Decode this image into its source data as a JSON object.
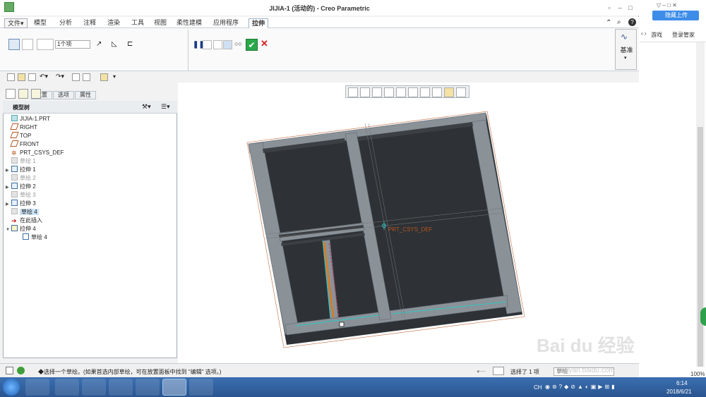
{
  "window": {
    "title": "JIJIA-1 (活动的) - Creo Parametric",
    "controls": [
      "?",
      "–",
      "□",
      "✕"
    ]
  },
  "menu": {
    "items": [
      "文件▾",
      "模型",
      "分析",
      "注释",
      "渲染",
      "工具",
      "视图",
      "柔性建模",
      "应用程序",
      "拉伸"
    ]
  },
  "ribbon": {
    "depth_value": "1个项",
    "subtabs": [
      "放置",
      "选项",
      "属性"
    ],
    "datum_label": "基准"
  },
  "tree": {
    "title": "模型树",
    "nodes": [
      {
        "label": "JIJIA-1.PRT",
        "icon": "part-icon",
        "level": 0,
        "exp": "",
        "state": "normal"
      },
      {
        "label": "RIGHT",
        "icon": "datum-plane-icon",
        "level": 1,
        "exp": "",
        "state": "normal"
      },
      {
        "label": "TOP",
        "icon": "datum-plane-icon",
        "level": 1,
        "exp": "",
        "state": "normal"
      },
      {
        "label": "FRONT",
        "icon": "datum-plane-icon",
        "level": 1,
        "exp": "",
        "state": "normal"
      },
      {
        "label": "PRT_CSYS_DEF",
        "icon": "csys-icon",
        "level": 1,
        "exp": "",
        "state": "normal"
      },
      {
        "label": "草绘 1",
        "icon": "sketch-icon",
        "level": 1,
        "exp": "",
        "state": "dim"
      },
      {
        "label": "拉伸 1",
        "icon": "extrude-icon",
        "level": 1,
        "exp": "▶",
        "state": "normal"
      },
      {
        "label": "草绘 2",
        "icon": "sketch-icon",
        "level": 1,
        "exp": "",
        "state": "dim"
      },
      {
        "label": "拉伸 2",
        "icon": "extrude-icon",
        "level": 1,
        "exp": "▶",
        "state": "normal"
      },
      {
        "label": "草绘 3",
        "icon": "sketch-icon",
        "level": 1,
        "exp": "",
        "state": "dim"
      },
      {
        "label": "拉伸 3",
        "icon": "extrude-icon",
        "level": 1,
        "exp": "▶",
        "state": "normal"
      },
      {
        "label": "草绘 4",
        "icon": "sketch-icon",
        "level": 1,
        "exp": "",
        "state": "sel"
      },
      {
        "label": "在此插入",
        "icon": "insert-arrow-icon",
        "level": 1,
        "exp": "",
        "state": "normal"
      },
      {
        "label": "拉伸 4",
        "icon": "extrude-icon",
        "level": 1,
        "exp": "▼",
        "state": "normal"
      },
      {
        "label": "草绘 4",
        "icon": "sketch-icon",
        "level": 2,
        "exp": "",
        "state": "normal"
      }
    ]
  },
  "graphics": {
    "csys_label": "PRT_CSYS_DEF"
  },
  "status": {
    "message": "◆选择一个草绘。(如果首选内部草绘，可在放置面板中找到 \"编辑\" 选项。)",
    "selected": "选择了 1 项",
    "filter": "草绘"
  },
  "side": {
    "upload_label": "隐藏上传",
    "game_label": "游戏",
    "login_label": "登录管家",
    "zoom": "100%"
  },
  "taskbar": {
    "lang": "CH",
    "time": "6:14",
    "date": "2018/6/21"
  },
  "watermark": {
    "text": "Bai du 经验",
    "url": "jingyan.baidu.com"
  },
  "colors": {
    "beam": "#8a9298",
    "beam_dark": "#3c4044",
    "accent_orange": "#e07a1a",
    "confirm_green": "#2aa84a",
    "cancel_red": "#d92020"
  }
}
